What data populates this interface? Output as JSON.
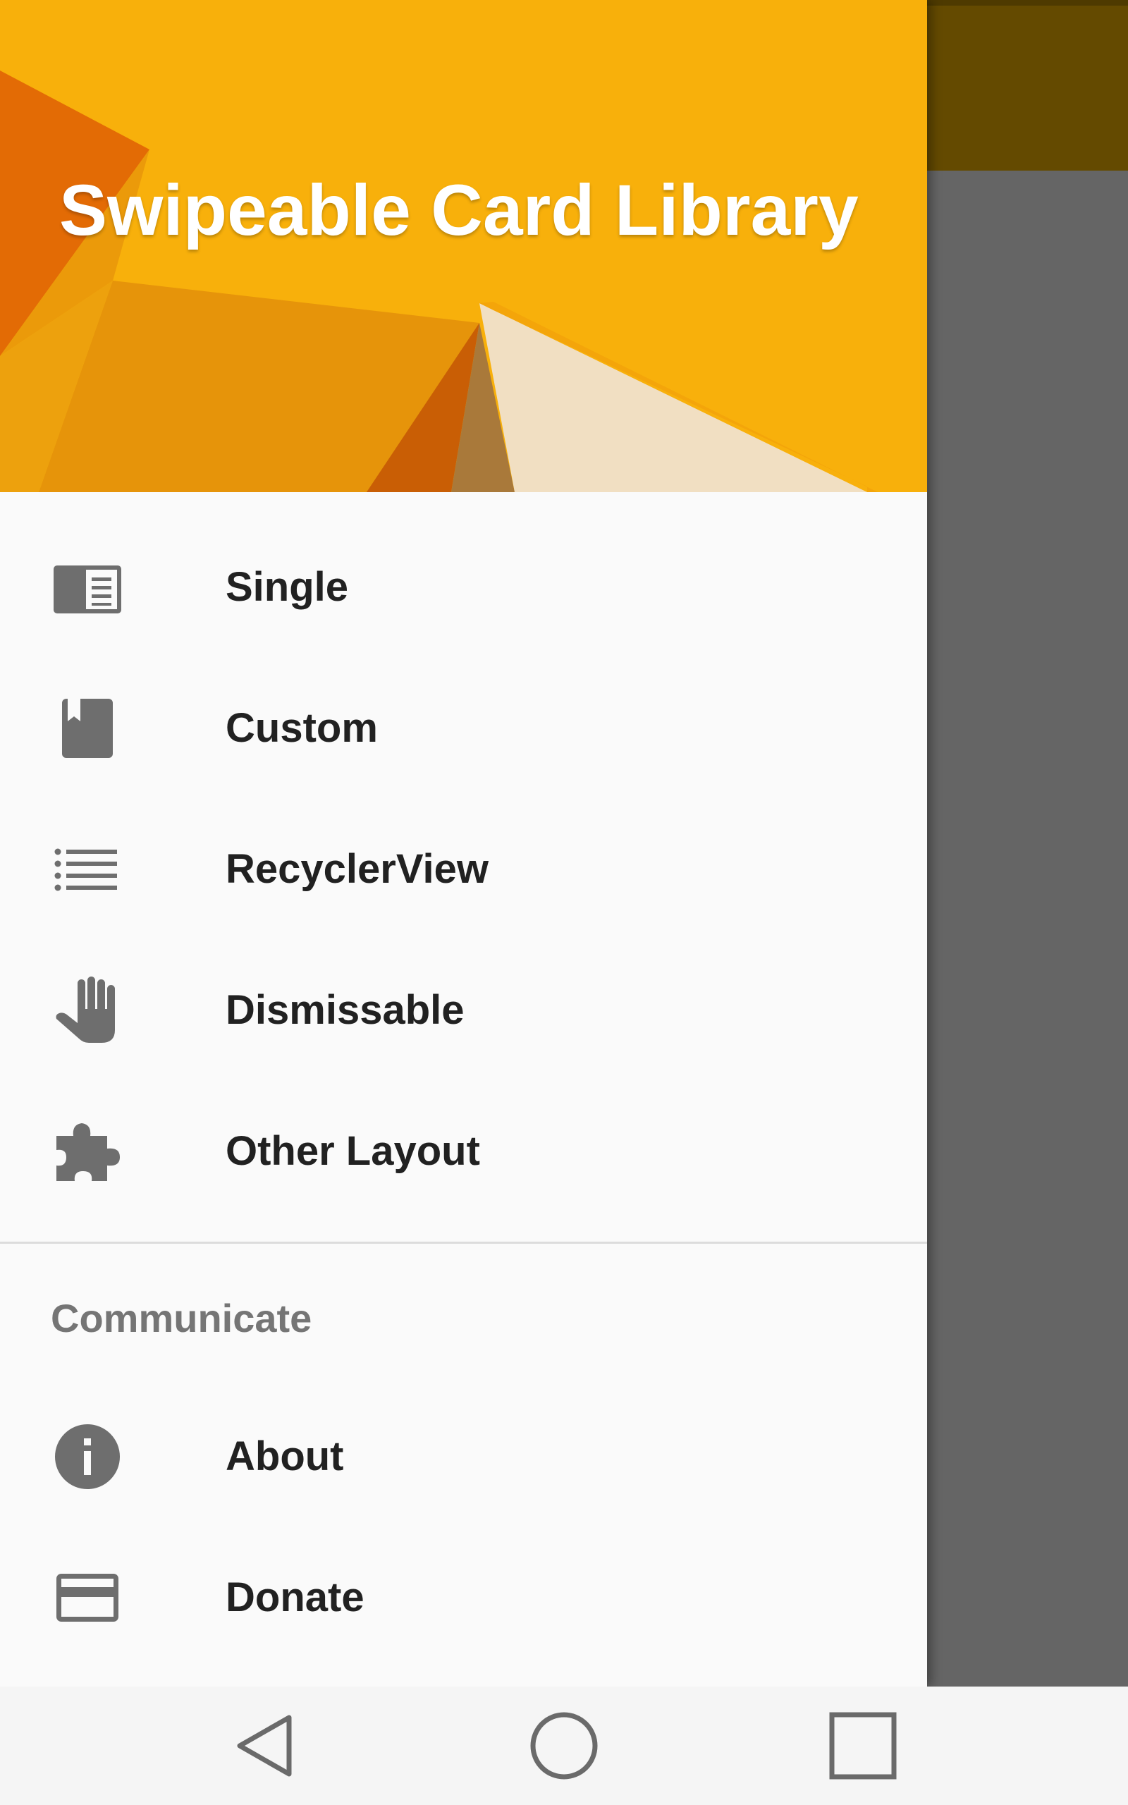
{
  "drawer": {
    "header_title": "Swipeable Card Library",
    "items": [
      {
        "label": "Single",
        "icon": "card-list-icon"
      },
      {
        "label": "Custom",
        "icon": "bookmark-icon"
      },
      {
        "label": "RecyclerView",
        "icon": "list-icon"
      },
      {
        "label": "Dismissable",
        "icon": "hand-icon"
      },
      {
        "label": "Other Layout",
        "icon": "puzzle-icon"
      }
    ],
    "section_header": "Communicate",
    "section_items": [
      {
        "label": "About",
        "icon": "info-icon"
      },
      {
        "label": "Donate",
        "icon": "credit-card-icon"
      }
    ]
  },
  "navbar": {
    "buttons": [
      "back-icon",
      "home-icon",
      "recents-icon"
    ]
  },
  "colors": {
    "header_orange": "#f8b00b",
    "icon_gray": "#6e6e6e",
    "text_dark": "#212121",
    "section_gray": "#757575",
    "scrim_toolbar": "#644a00",
    "scrim_content": "#656565"
  }
}
